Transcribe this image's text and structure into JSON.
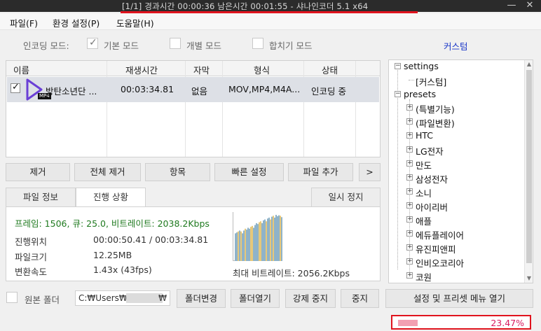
{
  "window": {
    "title": "[1/1] 경과시간 00:00:36   남은시간 00:01:55  -  샤나인코더 5.1 x64",
    "minimize": "—",
    "close": "✕"
  },
  "menu": [
    "파일(F)",
    "환경 설정(P)",
    "도움말(H)"
  ],
  "modes": {
    "label": "인코딩 모드:",
    "basic": "기본 모드",
    "separate": "개별 모드",
    "merge": "합치기 모드",
    "custom": "커스텀"
  },
  "file_list": {
    "columns": [
      "이름",
      "재생시간",
      "자막",
      "형식",
      "상태"
    ],
    "rows": [
      {
        "name": "방탄소년단 ...",
        "duration": "00:03:34.81",
        "subtitle": "없음",
        "format": "MOV,MP4,M4A...",
        "status": "인코딩 중",
        "icon_tag": "MP4"
      }
    ]
  },
  "actions": [
    "제거",
    "전체 제거",
    "항목",
    "빠른 설정",
    "파일 추가",
    ">"
  ],
  "tabs": {
    "file_info": "파일 정보",
    "progress": "진행 상황",
    "pause": "일시 정지"
  },
  "progress_panel": {
    "stats": "프레임: 1506, 큐: 25.0, 비트레이트: 2038.2Kbps",
    "position_label": "진행위치",
    "position_value": "00:00:50.41 / 00:03:34.81",
    "size_label": "파일크기",
    "size_value": "12.25MB",
    "speed_label": "변환속도",
    "speed_value": "1.43x (43fps)",
    "max_bitrate": "최대 비트레이트: 2056.2Kbps",
    "bitrate_fraction": [
      0.6,
      0.62,
      0.64,
      0.66,
      0.64,
      0.6,
      0.66,
      0.7,
      0.68,
      0.72,
      0.7,
      0.74,
      0.76,
      0.72,
      0.78,
      0.82,
      0.8,
      0.84,
      0.86,
      0.82,
      0.88,
      0.9,
      0.86,
      0.92,
      0.94,
      0.9,
      0.96,
      0.98,
      0.94,
      1.0,
      0.97,
      0.99,
      0.98,
      0.95,
      0.97
    ]
  },
  "tree": {
    "settings": "settings",
    "custom": "[커스텀]",
    "presets": "presets",
    "items": [
      "(특별기능)",
      "(파일변환)",
      "HTC",
      "LG전자",
      "만도",
      "삼성전자",
      "소니",
      "아이리버",
      "애플",
      "에듀플레이어",
      "유진피앤피",
      "인비오코리아",
      "코원"
    ]
  },
  "bottom": {
    "source_folder": "원본 폴더",
    "path_start": "C:₩Users₩",
    "path_end": "₩",
    "change_folder": "폴더변경",
    "open_folder": "폴더열기",
    "force_stop": "강제 중지",
    "stop": "중지",
    "settings_menu": "설정 및 프리셋 메뉴 열기"
  },
  "status": {
    "progress_text": "23.47%",
    "progress": 0.2347
  },
  "colors": {
    "accent_red": "#e0141e",
    "progress_pink": "#d81b60",
    "green_text": "#1f7a1f",
    "link_blue": "#1a36c7"
  }
}
